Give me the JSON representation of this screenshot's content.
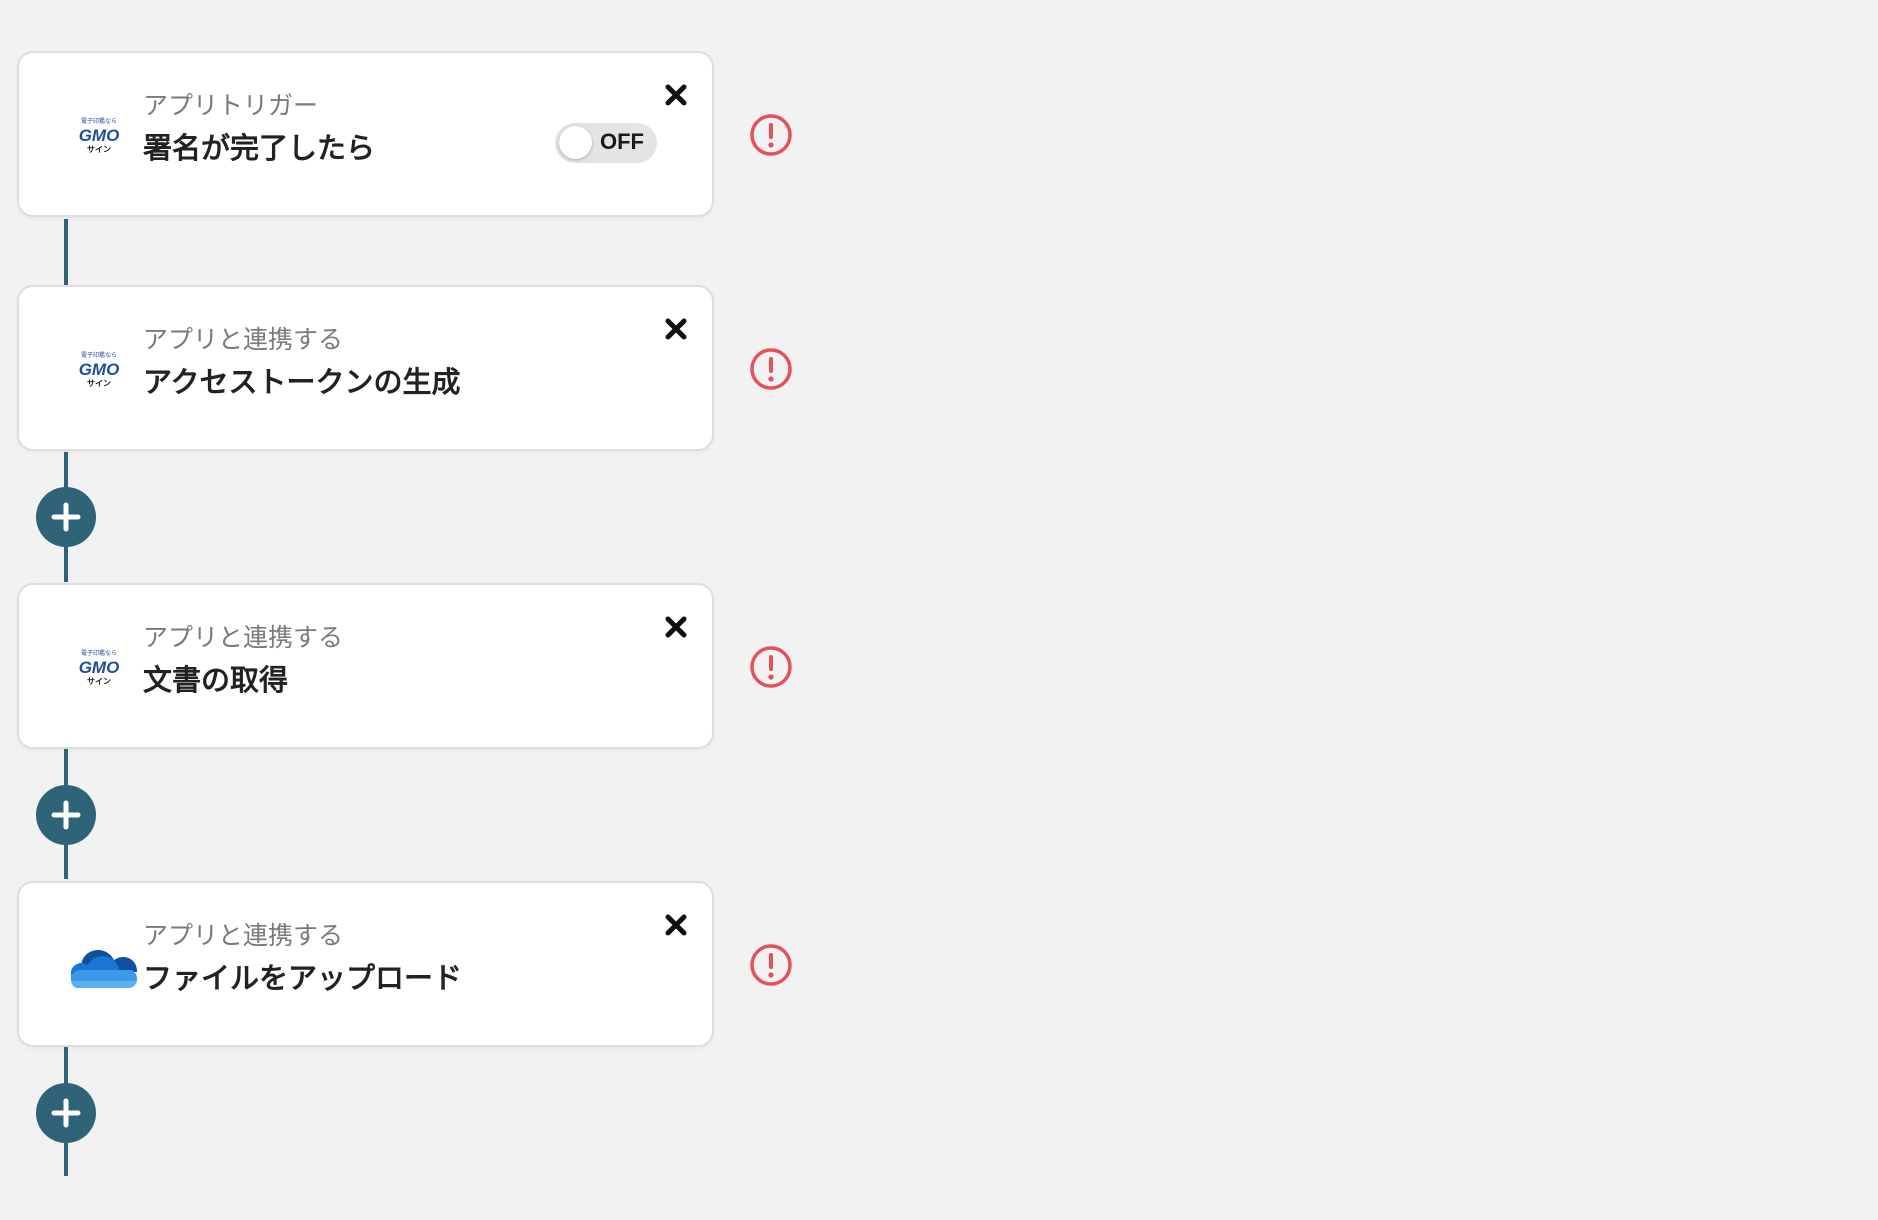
{
  "steps": [
    {
      "type_label": "アプリトリガー",
      "title": "署名が完了したら",
      "app": "GMOサイン",
      "app_icon": "gmo-sign-logo",
      "toggle": {
        "state": "OFF"
      }
    },
    {
      "type_label": "アプリと連携する",
      "title": "アクセストークンの生成",
      "app": "GMOサイン",
      "app_icon": "gmo-sign-logo"
    },
    {
      "type_label": "アプリと連携する",
      "title": "文書の取得",
      "app": "GMOサイン",
      "app_icon": "gmo-sign-logo"
    },
    {
      "type_label": "アプリと連携する",
      "title": "ファイルをアップロード",
      "app": "OneDrive",
      "app_icon": "onedrive-logo"
    }
  ],
  "gmo_logo_text": {
    "top": "電子印鑑なら",
    "main": "GMO",
    "bottom": "サイン"
  },
  "icons": {
    "close": "close-icon",
    "warning": "warning-icon",
    "add": "plus-icon"
  },
  "colors": {
    "background": "#f2f2f2",
    "connector": "#2f6478",
    "add_button": "#2f6478",
    "warning": "#e5505a",
    "gmo_blue": "#1f4e9c"
  }
}
